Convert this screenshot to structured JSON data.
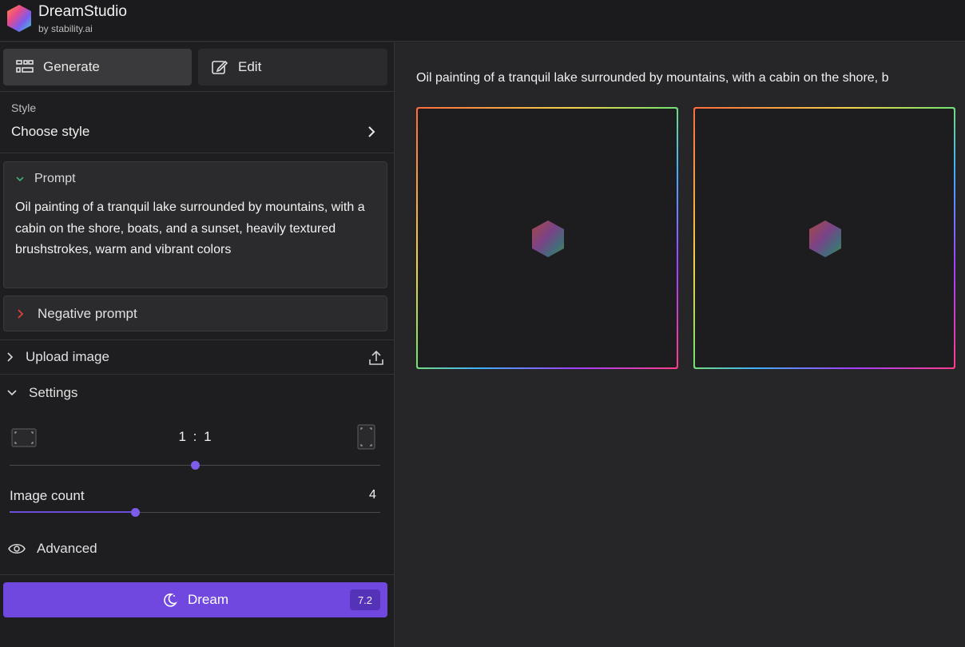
{
  "app": {
    "title": "DreamStudio",
    "subtitle": "by stability.ai"
  },
  "tabs": {
    "generate": "Generate",
    "edit": "Edit"
  },
  "style": {
    "label": "Style",
    "value": "Choose style"
  },
  "prompt": {
    "title": "Prompt",
    "text": "Oil painting of a tranquil lake surrounded by mountains, with a cabin on the shore, boats, and a sunset, heavily textured brushstrokes, warm and vibrant colors"
  },
  "negative_prompt": {
    "title": "Negative prompt"
  },
  "upload": {
    "label": "Upload image"
  },
  "settings": {
    "label": "Settings",
    "aspect_ratio": "1 : 1",
    "aspect_ratio_slider_fraction": 0.49,
    "image_count_label": "Image count",
    "image_count": "4",
    "image_count_slider_fraction": 0.33
  },
  "advanced": {
    "label": "Advanced"
  },
  "dream_button": {
    "label": "Dream",
    "cost": "7.2"
  },
  "main": {
    "prompt_text": "Oil painting of a tranquil lake surrounded by mountains, with a cabin on the shore, b"
  },
  "colors": {
    "accent": "#7048e0",
    "accent_dark": "#5533b8",
    "sidebar_bg": "#1e1e20",
    "main_bg": "#262628"
  },
  "icons": {
    "logo": "hexagon-gradient-logo",
    "generate": "grid-icon",
    "edit": "edit-icon",
    "dream": "moon-icon"
  }
}
